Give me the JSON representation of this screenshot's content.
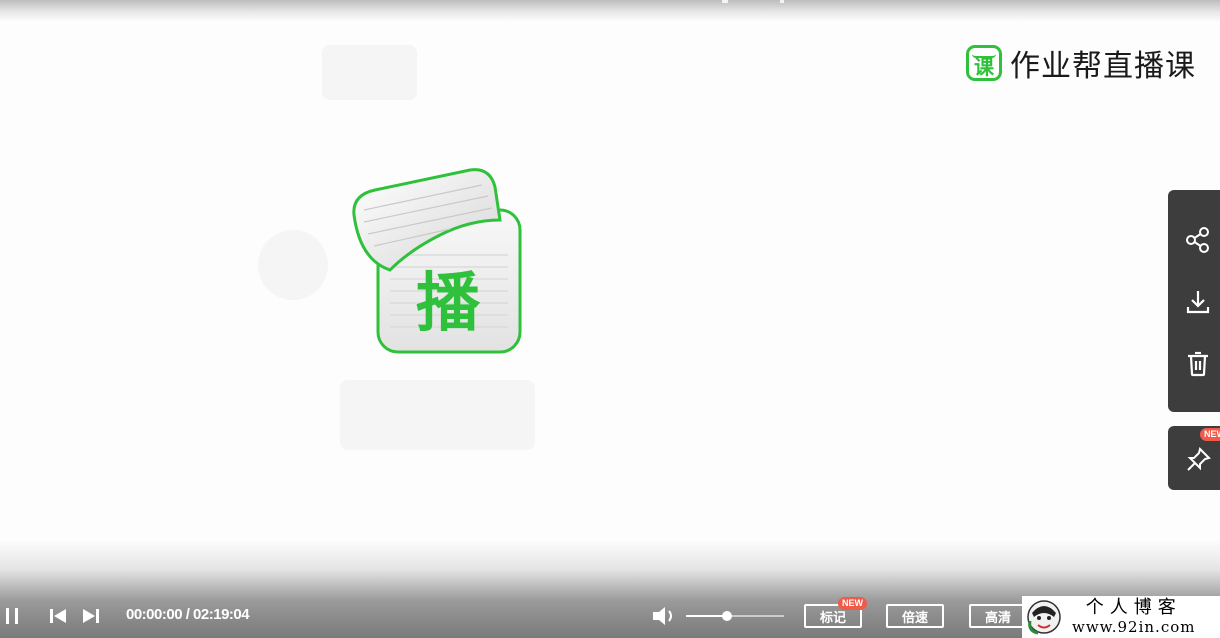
{
  "brand": {
    "icon_char": "课",
    "name": "作业帮直播课",
    "color": "#2fc13b"
  },
  "video": {
    "logo_char": "播",
    "logo_color": "#2fc13b"
  },
  "side_tools": {
    "icons": [
      "share-icon",
      "download-icon",
      "delete-icon"
    ],
    "pin_icon": "pin-icon",
    "pin_badge": "NEW"
  },
  "player": {
    "current_time": "00:00:00",
    "duration": "02:19:04",
    "time_display": "00:00:00 / 02:19:04",
    "volume_level": 0.42,
    "buttons": {
      "mark": "标记",
      "mark_badge": "NEW",
      "speed": "倍速",
      "quality": "高清"
    }
  },
  "watermark": {
    "title": "个人博客",
    "url": "www.92in.com"
  }
}
